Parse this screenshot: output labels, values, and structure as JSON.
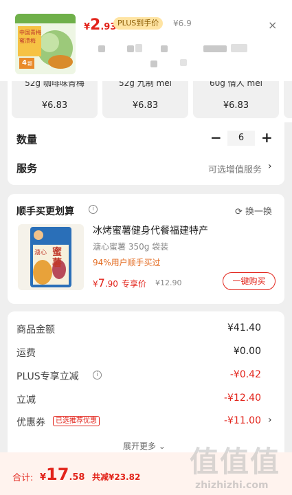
{
  "header": {
    "price_symbol": "¥",
    "price_int": "2",
    "price_dec": ".93",
    "plus_badge": "PLUS到手价",
    "original_price": "¥6.9",
    "close_icon": "×",
    "thumb_text_1": "中国青梅",
    "thumb_text_2": "蜜渍梅",
    "thumb_text_3": "4",
    "thumb_text_3_unit": "颗"
  },
  "variants": [
    {
      "name": "52g 咖啡味青梅",
      "price": "¥6.83"
    },
    {
      "name": "52g 九制 mei",
      "price": "¥6.83"
    },
    {
      "name": "60g 情人 mei",
      "price": "¥6.83"
    }
  ],
  "quantity": {
    "label": "数量",
    "minus": "−",
    "value": "6",
    "plus": "+"
  },
  "service": {
    "label": "服务",
    "value": "可选增值服务",
    "chevron": "›"
  },
  "bundle": {
    "title": "顺手买更划算",
    "info_icon": "i",
    "swap_label": "换一换",
    "swap_icon": "⟳",
    "product": {
      "title": "冰烤蜜薯健身代餐福建特产",
      "subtitle": "溏心蜜薯 350g 袋装",
      "percent": "94%用户顺手买过",
      "price_symbol": "¥",
      "price_int": "7",
      "price_dec": ".90",
      "price_tag": "专享价",
      "original_price": "¥12.90",
      "buy_button": "一键购买",
      "img_text_1": "溏心",
      "img_text_2": "蜜",
      "img_text_3": "薯"
    }
  },
  "fees": [
    {
      "label": "商品金额",
      "value": "¥41.40",
      "red": false
    },
    {
      "label": "运费",
      "value": "¥0.00",
      "red": false
    },
    {
      "label": "PLUS专享立减",
      "value": "-¥0.42",
      "red": true
    },
    {
      "label": "立减",
      "value": "-¥12.40",
      "red": true
    },
    {
      "label": "优惠券",
      "value": "-¥11.00",
      "red": true
    }
  ],
  "coupon_badge": "已选推荐优惠",
  "coupon_chevron": "›",
  "expand_more": "展开更多 ⌄",
  "bottom": {
    "total_label": "合计:",
    "total_symbol": "¥",
    "total_int": "17",
    "total_dec": ".58",
    "saved": "共减¥23.82"
  },
  "watermark": {
    "chars": "值值值",
    "url": "zhizhizhi.com"
  },
  "colors": {
    "accent": "#e2231a",
    "plus_badge_bg": "#ffe4a3",
    "background": "#efefef"
  }
}
